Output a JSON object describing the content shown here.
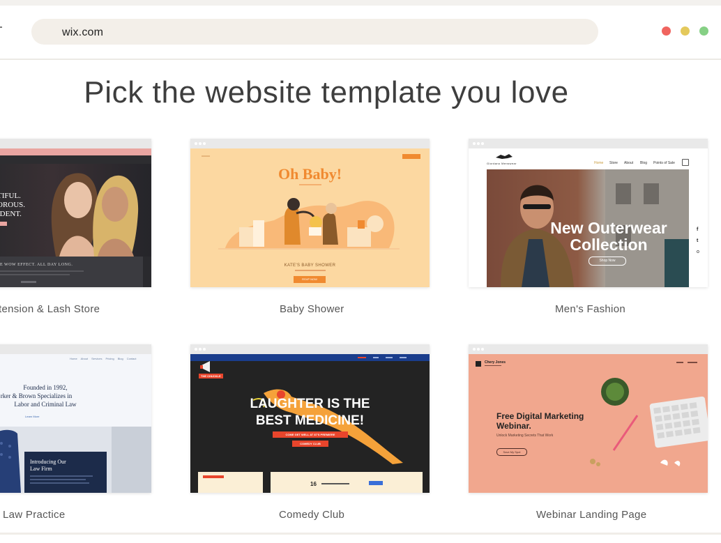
{
  "browser": {
    "url": "wix.com",
    "window_controls": [
      "close",
      "minimize",
      "maximize"
    ]
  },
  "page": {
    "headline": "Pick the website template you love"
  },
  "templates": [
    {
      "label": "tension & Lash Store",
      "preview": {
        "hero_lines": [
          "TIFUL.",
          "OROUS.",
          "IDENT."
        ],
        "tagline": "E WOW EFFECT. ALL DAY LONG."
      }
    },
    {
      "label": "Baby Shower",
      "preview": {
        "title": "Oh Baby!",
        "event": "KATE'S BABY SHOWER",
        "button": "RSVP NOW"
      }
    },
    {
      "label": "Men's Fashion",
      "preview": {
        "brand": "Giordano Menswear",
        "nav": [
          "Home",
          "Store",
          "About",
          "Blog",
          "Points of Sale"
        ],
        "hero_title_1": "New Outerwear",
        "hero_title_2": "Collection",
        "button": "Shop Now",
        "social": [
          "f",
          "t",
          "o"
        ]
      }
    },
    {
      "label": "Law Practice",
      "preview": {
        "nav": [
          "Home",
          "About",
          "Services",
          "Pricing",
          "Blog",
          "Contact"
        ],
        "hero_lines": [
          "Founded in 1992,",
          "rker & Brown Specializes in",
          "Labor and Criminal Law"
        ],
        "link": "Learn More",
        "panel_title_1": "Introducing Our",
        "panel_title_2": "Law Firm"
      }
    },
    {
      "label": "Comedy Club",
      "preview": {
        "badge": "THE CHUCKLE",
        "headline_1": "LAUGHTER IS THE",
        "headline_2": "BEST MEDICINE!",
        "banner": "COME GET WELL AT 87'S PREMIERE",
        "button": "COMEDY CLUB",
        "date": "16"
      }
    },
    {
      "label": "Webinar Landing Page",
      "preview": {
        "brand": "Chery Jones",
        "title_1": "Free Digital Marketing",
        "title_2": "Webinar.",
        "subtitle": "Unlock Marketing Secrets That Work",
        "button": "Save My Spot"
      }
    }
  ],
  "colors": {
    "accent_red": "#f0645f",
    "accent_yellow": "#e4c95c",
    "accent_green": "#86d085",
    "comedy_bg": "#232323",
    "webinar_bg": "#f1a78e",
    "baby_bg": "#fcd8a1"
  }
}
